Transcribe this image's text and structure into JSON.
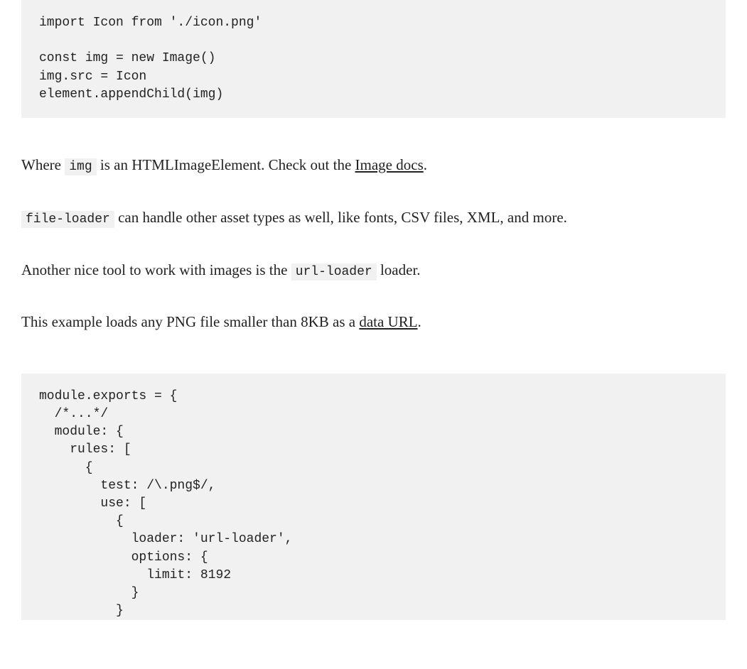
{
  "code1": "import Icon from './icon.png'\n\nconst img = new Image()\nimg.src = Icon\nelement.appendChild(img)",
  "para1": {
    "t0": "Where ",
    "code0": "img",
    "t1": " is an HTMLImageElement. Check out the ",
    "link0": "Image docs",
    "t2": "."
  },
  "para2": {
    "code0": "file-loader",
    "t0": " can handle other asset types as well, like fonts, CSV files, XML, and more."
  },
  "para3": {
    "t0": "Another nice tool to work with images is the ",
    "code0": "url-loader",
    "t1": " loader."
  },
  "para4": {
    "t0": "This example loads any PNG file smaller than 8KB as a ",
    "link0": "data URL",
    "t1": "."
  },
  "code2": "module.exports = {\n  /*...*/\n  module: {\n    rules: [\n      {\n        test: /\\.png$/,\n        use: [\n          {\n            loader: 'url-loader',\n            options: {\n              limit: 8192\n            }\n          }"
}
